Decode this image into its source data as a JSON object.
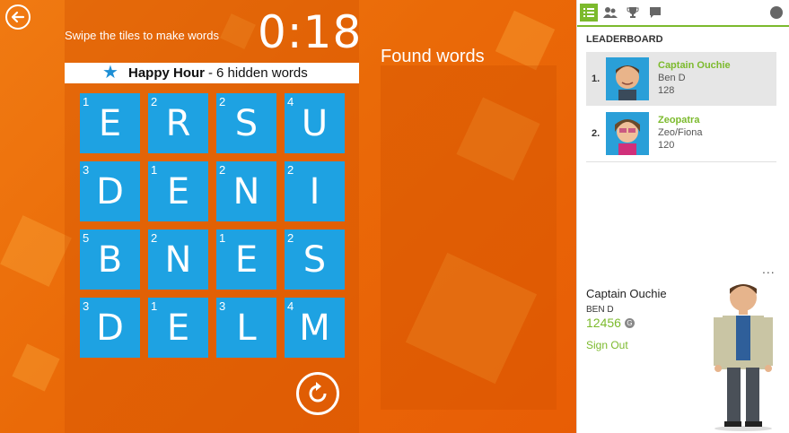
{
  "game": {
    "instructions": "Swipe the tiles to make words",
    "timer": "0:18",
    "banner": {
      "title": "Happy Hour",
      "separator": "-",
      "subtitle": "6 hidden words"
    },
    "found_words_title": "Found words",
    "tiles": [
      {
        "letter": "E",
        "points": "1"
      },
      {
        "letter": "R",
        "points": "2"
      },
      {
        "letter": "S",
        "points": "2"
      },
      {
        "letter": "U",
        "points": "4"
      },
      {
        "letter": "D",
        "points": "3"
      },
      {
        "letter": "E",
        "points": "1"
      },
      {
        "letter": "N",
        "points": "2"
      },
      {
        "letter": "I",
        "points": "2"
      },
      {
        "letter": "B",
        "points": "5"
      },
      {
        "letter": "N",
        "points": "2"
      },
      {
        "letter": "E",
        "points": "1"
      },
      {
        "letter": "S",
        "points": "2"
      },
      {
        "letter": "D",
        "points": "3"
      },
      {
        "letter": "E",
        "points": "1"
      },
      {
        "letter": "L",
        "points": "3"
      },
      {
        "letter": "M",
        "points": "4"
      }
    ],
    "icons": {
      "back": "back-arrow-icon",
      "refresh": "refresh-icon",
      "star": "star-icon"
    }
  },
  "panel": {
    "tabs": [
      "leaderboard-tab",
      "friends-tab",
      "achievements-tab",
      "messages-tab"
    ],
    "leaderboard_title": "LEADERBOARD",
    "leaderboard": [
      {
        "rank": "1.",
        "gamertag": "Captain Ouchie",
        "name": "Ben D",
        "score": "128"
      },
      {
        "rank": "2.",
        "gamertag": "Zeopatra",
        "name": "Zeo/Fiona",
        "score": "120"
      }
    ],
    "more": "...",
    "profile": {
      "gamertag": "Captain Ouchie",
      "realname": "BEN D",
      "score": "12456",
      "gamerscore_icon": "G",
      "signout": "Sign Out"
    }
  },
  "colors": {
    "orange": "#ea6a08",
    "tile_blue": "#1ea2e2",
    "accent_green": "#7cba2d"
  }
}
